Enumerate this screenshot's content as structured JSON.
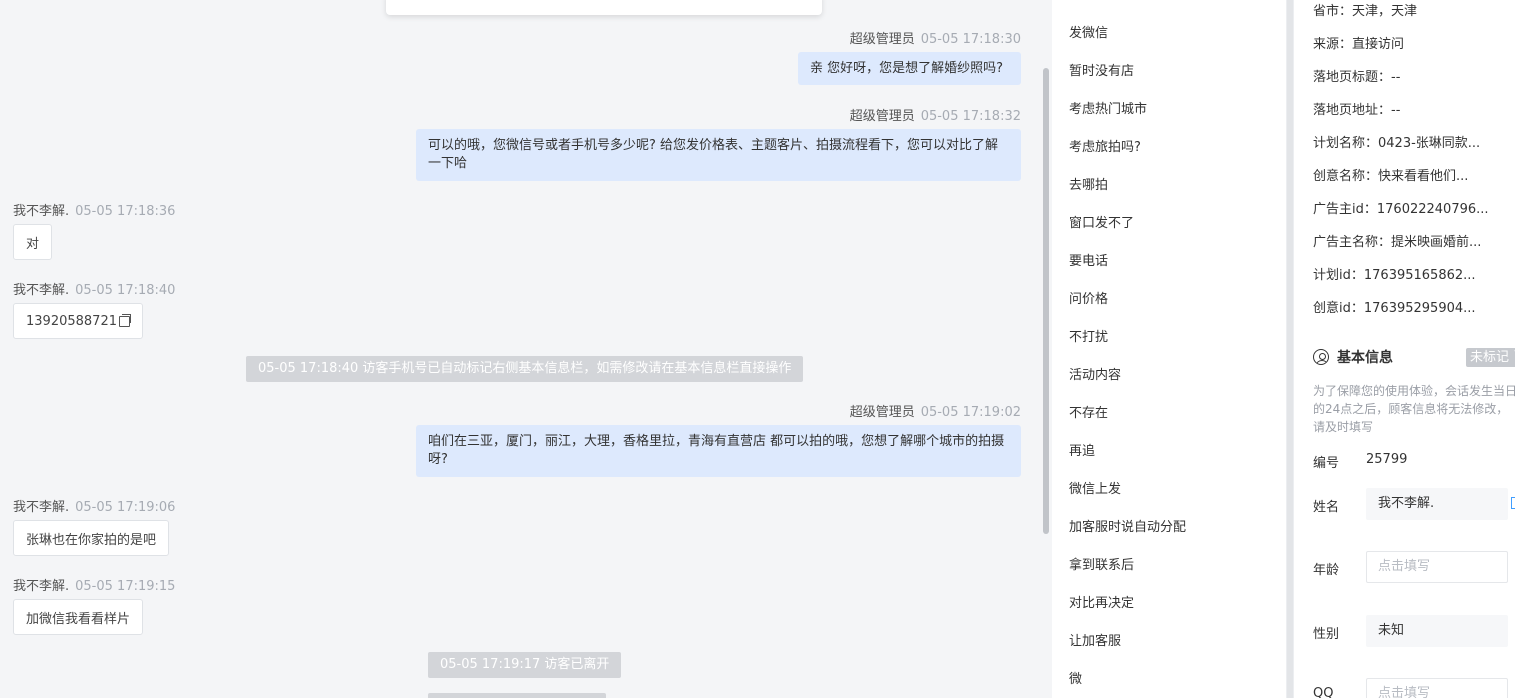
{
  "chat": {
    "messages": [
      {
        "who": "超级管理员",
        "time": "05-05 17:18:30",
        "text": "亲 您好呀，您是想了解婚纱照吗?"
      },
      {
        "who": "超级管理员",
        "time": "05-05 17:18:32",
        "text": "可以的哦，您微信号或者手机号多少呢? 给您发价格表、主题客片、拍摄流程看下，您可以对比了解一下哈"
      },
      {
        "who": "我不李解.",
        "time": "05-05 17:18:36",
        "text": "对"
      },
      {
        "who": "我不李解.",
        "time": "05-05 17:18:40",
        "text": "13920588721"
      },
      {
        "who": "超级管理员",
        "time": "05-05 17:19:02",
        "text": "咱们在三亚，厦门，丽江，大理，香格里拉，青海有直营店 都可以拍的哦，您想了解哪个城市的拍摄呀?"
      },
      {
        "who": "我不李解.",
        "time": "05-05 17:19:06",
        "text": "张琳也在你家拍的是吧"
      },
      {
        "who": "我不李解.",
        "time": "05-05 17:19:15",
        "text": "加微信我看看样片"
      }
    ],
    "system": [
      "05-05 17:18:40 访客手机号已自动标记右侧基本信息栏，如需修改请在基本信息栏直接操作",
      "05-05 17:19:17 访客已离开"
    ]
  },
  "quick_replies": [
    "发微信",
    "暂时没有店",
    "考虑热门城市",
    "考虑旅拍吗?",
    "去哪拍",
    "窗口发不了",
    "要电话",
    "问价格",
    "不打扰",
    "活动内容",
    "不存在",
    "再追",
    "微信上发",
    "加客服时说自动分配",
    "拿到联系后",
    "对比再决定",
    "让加客服",
    "微"
  ],
  "source_info": [
    {
      "label": "省市：",
      "value": "天津，天津"
    },
    {
      "label": "来源：",
      "value": "直接访问"
    },
    {
      "label": "落地页标题：",
      "value": "--"
    },
    {
      "label": "落地页地址：",
      "value": "--"
    },
    {
      "label": "计划名称：",
      "value": "0423-张琳同款..."
    },
    {
      "label": "创意名称：",
      "value": "快来看看他们..."
    },
    {
      "label": "广告主id：",
      "value": "176022240796..."
    },
    {
      "label": "广告主名称：",
      "value": "提米映画婚前..."
    },
    {
      "label": "计划id：",
      "value": "176395165862..."
    },
    {
      "label": "创意id：",
      "value": "176395295904..."
    }
  ],
  "basic_info": {
    "title": "基本信息",
    "mark_select": "未标记",
    "privacy_note": "为了保障您的使用体验，会话发生当日的24点之后，顾客信息将无法修改，请及时填写",
    "id_label": "编号",
    "id_value": "25799",
    "name_label": "姓名",
    "name_value": "我不李解.",
    "age_label": "年龄",
    "age_placeholder": "点击填写",
    "gender_label": "性别",
    "gender_value": "未知",
    "qq_label": "QQ",
    "qq_placeholder": "点击填写"
  },
  "colors": {
    "agent_bubble": "#dde9fd",
    "chat_bg": "#f4f5f7",
    "system_bg": "#d3d5d9"
  }
}
